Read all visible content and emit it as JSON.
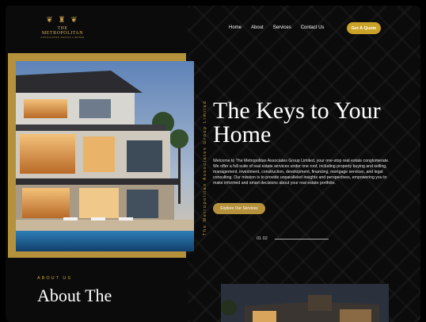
{
  "header": {
    "logo_name": "THE METROPOLITAN",
    "logo_sub": "ASSOCIATES GROUP LIMITED",
    "nav": [
      "Home",
      "About",
      "Services",
      "Contact Us"
    ],
    "cta": "Get A Quote"
  },
  "hero": {
    "vertical_tagline": "The Metropolitan Associates Group Limited",
    "title_line1": "The Keys to Your",
    "title_line2": "Home",
    "description": "Welcome to The Metropolitan Associates Group Limited, your one-stop real estate conglomerate. We offer a full suite of real estate services under one roof, including property buying and selling, management, investment, construction, development, financing, mortgage services, and legal consulting. Our mission is to provide unparalleled insights and perspectives, empowering you to make informed and smart decisions about your real estate portfolio.",
    "button": "Explore Our Services",
    "pager_current": "01",
    "pager_next": "02"
  },
  "about": {
    "kicker": "ABOUT US",
    "title": "About The"
  },
  "colors": {
    "gold": "#c9a227",
    "background": "#0b0b0b"
  }
}
